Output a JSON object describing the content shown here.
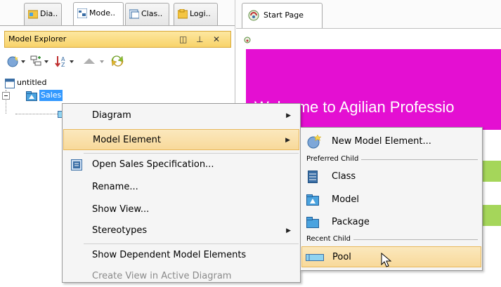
{
  "tabs": {
    "left": [
      {
        "label": "Dia.."
      },
      {
        "label": "Mode.."
      },
      {
        "label": "Clas.."
      },
      {
        "label": "Logi.."
      }
    ],
    "editor": {
      "label": "Start Page"
    }
  },
  "explorer": {
    "title": "Model Explorer",
    "tree": {
      "root": "untitled",
      "child": "Sales"
    }
  },
  "start_page": {
    "welcome": "Welcome to Agilian Professio"
  },
  "context_menu": {
    "items": [
      {
        "label": "Diagram"
      },
      {
        "label": "Model Element"
      },
      {
        "label": "Open Sales Specification..."
      },
      {
        "label": "Rename..."
      },
      {
        "label": "Show View..."
      },
      {
        "label": "Stereotypes"
      },
      {
        "label": "Show Dependent Model Elements"
      },
      {
        "label": "Create View in Active Diagram"
      }
    ]
  },
  "submenu": {
    "new_element": "New Model Element...",
    "preferred_header": "Preferred Child",
    "preferred": [
      {
        "label": "Class"
      },
      {
        "label": "Model"
      },
      {
        "label": "Package"
      }
    ],
    "recent_header": "Recent Child",
    "recent": [
      {
        "label": "Pool"
      }
    ]
  },
  "colors": {
    "banner": "#e40fd2",
    "highlight": "#f8d99a",
    "header": "#f8d36a",
    "accent_green": "#a5d65a"
  }
}
